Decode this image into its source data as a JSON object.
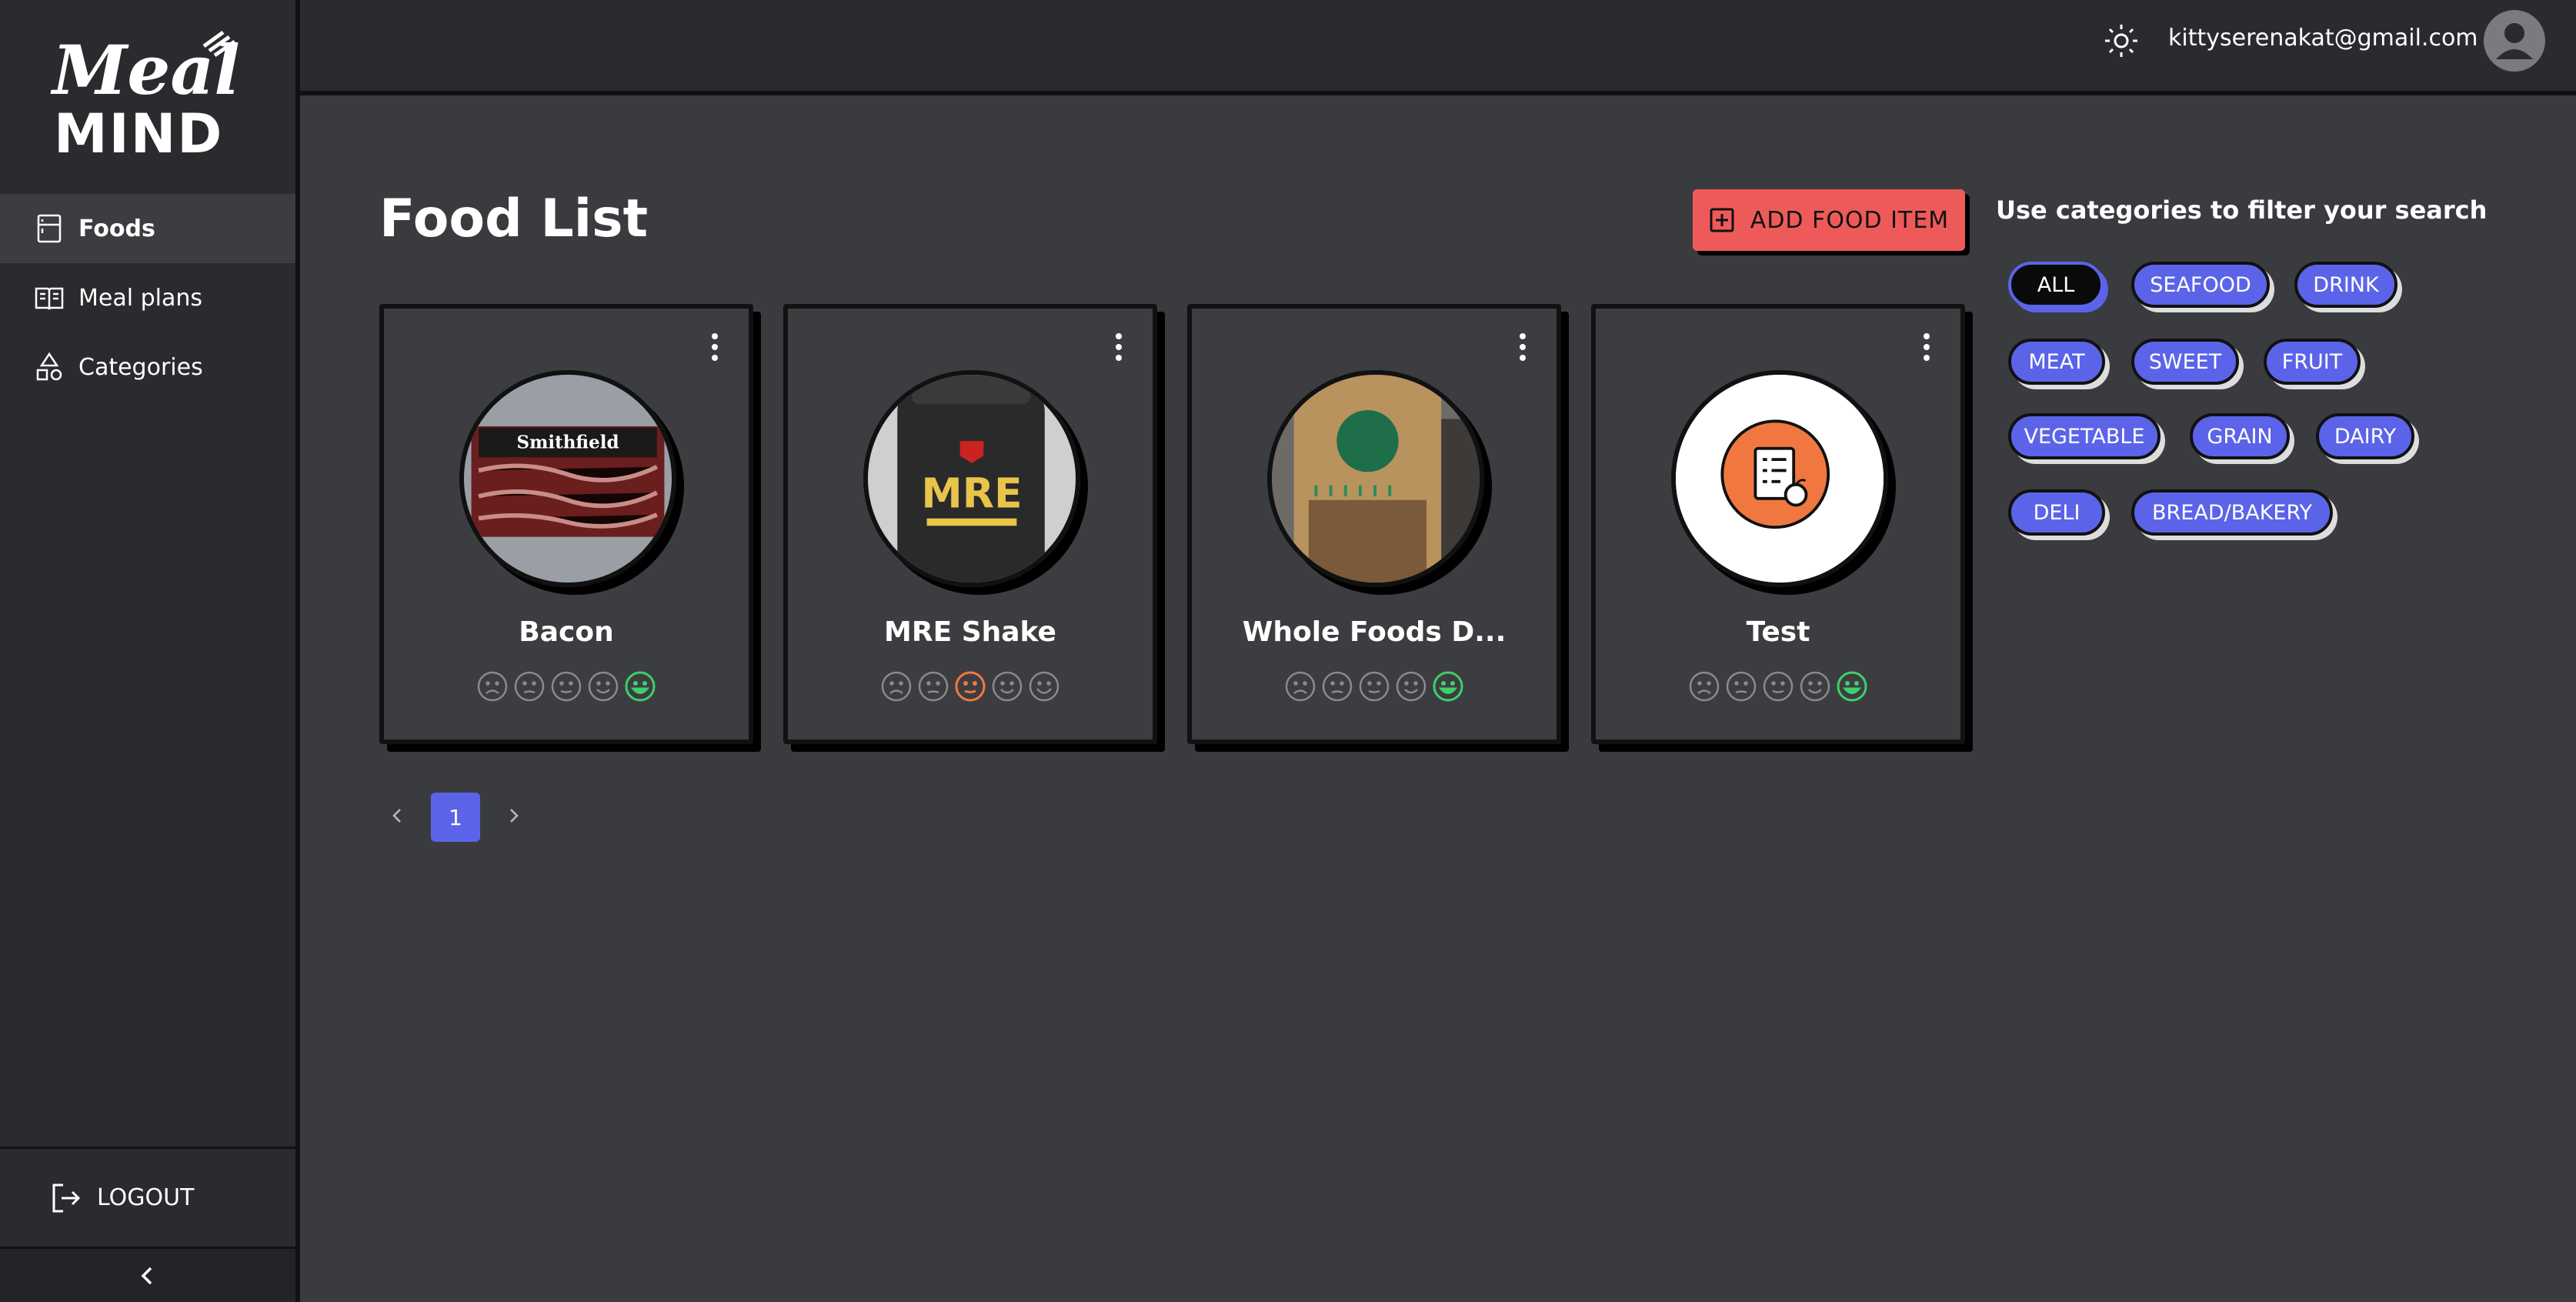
{
  "app": {
    "logo_text_top": "Meal",
    "logo_text_bottom": "MIND"
  },
  "sidebar": {
    "items": [
      {
        "label": "Foods",
        "icon": "fridge-icon",
        "active": true
      },
      {
        "label": "Meal plans",
        "icon": "book-icon",
        "active": false
      },
      {
        "label": "Categories",
        "icon": "shapes-icon",
        "active": false
      }
    ],
    "logout_label": "LOGOUT",
    "collapse_icon": "chevron-left-icon"
  },
  "header": {
    "theme_icon": "sun-icon",
    "email": "kittyserenakat@gmail.com",
    "avatar_icon": "user-avatar-icon"
  },
  "main": {
    "title": "Food List",
    "add_button_label": "ADD FOOD ITEM",
    "foods": [
      {
        "name": "Bacon",
        "rating": 5,
        "image": "bacon-photo"
      },
      {
        "name": "MRE Shake",
        "rating": 3,
        "image": "mre-shake-photo"
      },
      {
        "name": "Whole Foods D...",
        "rating": 5,
        "image": "whole-foods-bag-photo"
      },
      {
        "name": "Test",
        "rating": 5,
        "image": "placeholder-food-icon"
      }
    ],
    "pagination": {
      "current": "1"
    }
  },
  "filters": {
    "title": "Use categories to filter your search",
    "categories": [
      "ALL",
      "SEAFOOD",
      "DRINK",
      "MEAT",
      "SWEET",
      "FRUIT",
      "VEGETABLE",
      "GRAIN",
      "DAIRY",
      "DELI",
      "BREAD/BAKERY"
    ],
    "selected": "ALL"
  },
  "colors": {
    "background": "#3a3b3e",
    "sidebar": "#2a2b2e",
    "accent_red": "#ee5a5a",
    "accent_blue": "#5b64e8",
    "rating_good": "#3ecf6b",
    "rating_neutral": "#f07840",
    "rating_inactive": "#8a8a8a"
  }
}
